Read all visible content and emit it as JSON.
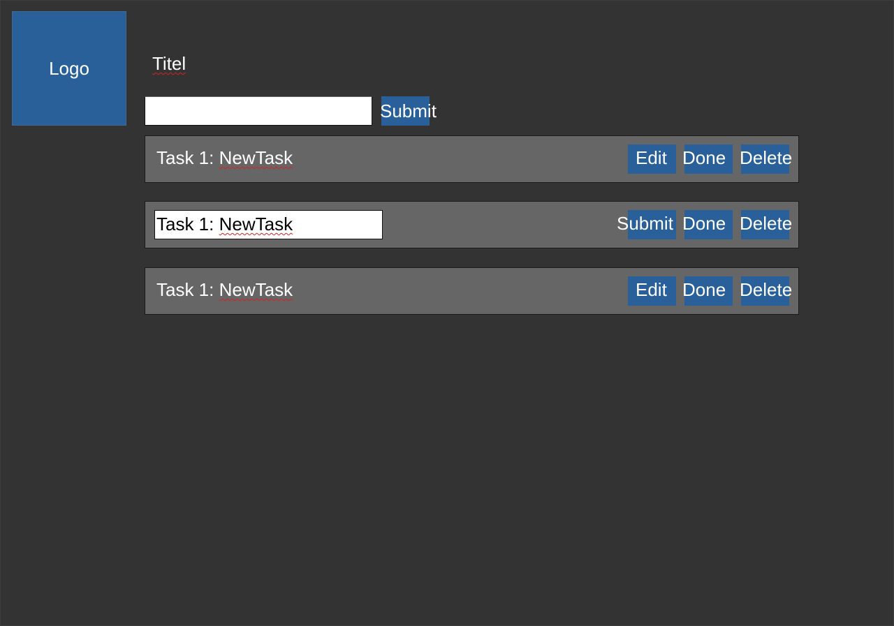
{
  "logo": {
    "label": "Logo"
  },
  "header": {
    "title": "Titel"
  },
  "new_task": {
    "input_value": "",
    "submit_label": "Submit"
  },
  "tasks": [
    {
      "prefix": "Task 1: ",
      "name": "NewTask",
      "mode": "view",
      "buttons": {
        "primary": "Edit",
        "done": "Done",
        "delete": "Delete"
      }
    },
    {
      "prefix": "Task 1: ",
      "name": "NewTask",
      "mode": "edit",
      "buttons": {
        "primary": "Submit",
        "done": "Done",
        "delete": "Delete"
      }
    },
    {
      "prefix": "Task 1: ",
      "name": "NewTask",
      "mode": "view",
      "buttons": {
        "primary": "Edit",
        "done": "Done",
        "delete": "Delete"
      }
    }
  ],
  "colors": {
    "background": "#333333",
    "accent": "#2a6099",
    "task_row": "#666666",
    "spellcheck": "#d62121"
  }
}
